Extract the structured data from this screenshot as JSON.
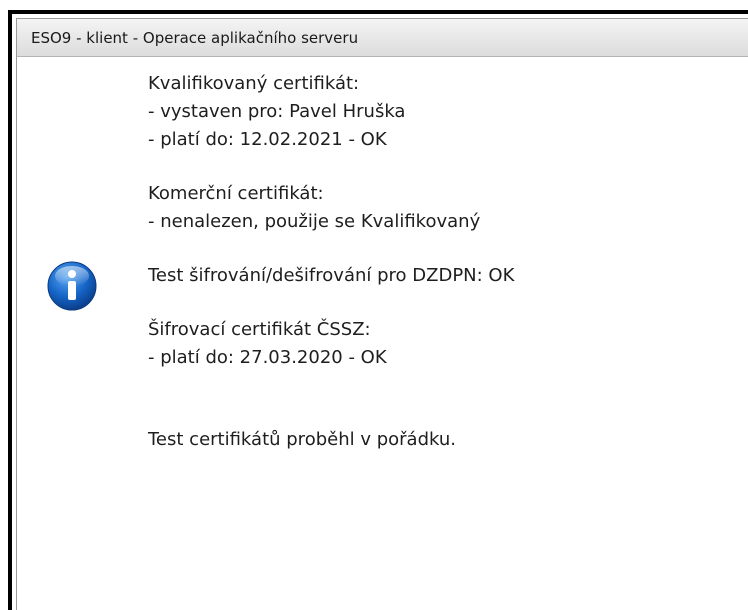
{
  "window": {
    "title": "ESO9 - klient - Operace aplikačního serveru"
  },
  "icon": {
    "name": "info-icon",
    "color": "#1565c8"
  },
  "message": {
    "qualified_heading": "Kvalifikovaný certifikát:",
    "qualified_issued_to": "- vystaven pro: Pavel Hruška",
    "qualified_valid_until": "- platí do: 12.02.2021 - OK",
    "commercial_heading": "Komerční certifikát:",
    "commercial_status": "- nenalezen, použije se Kvalifikovaný",
    "encryption_test": "Test šifrování/dešifrování pro DZDPN: OK",
    "cssz_heading": "Šifrovací certifikát ČSSZ:",
    "cssz_valid_until": "- platí do: 27.03.2020 - OK",
    "summary": "Test certifikátů proběhl v pořádku."
  }
}
